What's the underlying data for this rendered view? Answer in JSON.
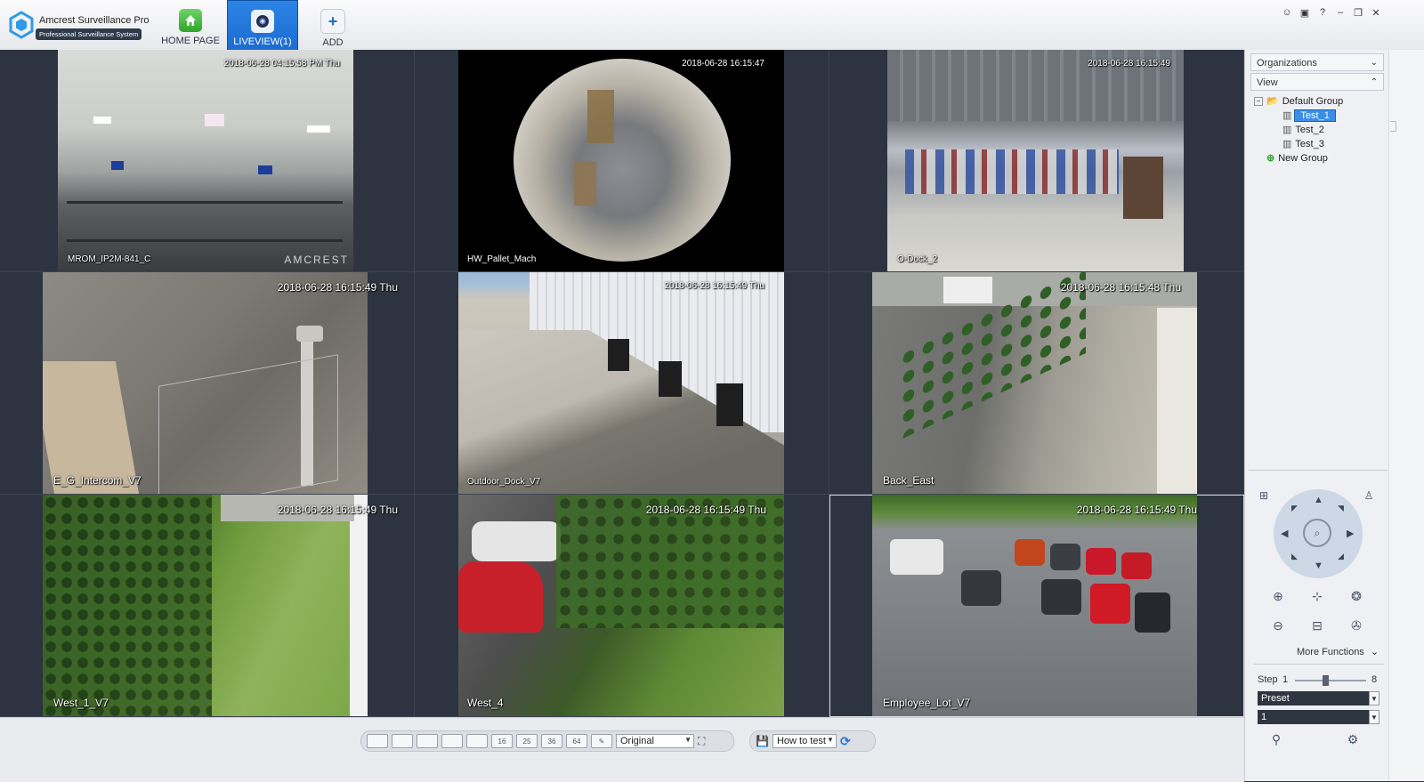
{
  "app": {
    "title": "Amcrest Surveillance Pro",
    "subtitle": "Professional Surveillance System"
  },
  "nav": {
    "tabs": [
      {
        "label": "HOME PAGE",
        "icon": "home-icon",
        "active": false
      },
      {
        "label": "LIVEVIEW(1)",
        "icon": "camera-icon",
        "active": true
      },
      {
        "label": "ADD",
        "icon": "plus-icon",
        "active": false
      }
    ]
  },
  "window_controls": [
    "user-icon",
    "lock-icon",
    "help-icon",
    "minimize-icon",
    "restore-icon",
    "close-icon"
  ],
  "window_control_glyphs": [
    "☺",
    "▣",
    "?",
    "–",
    "❐",
    "✕"
  ],
  "cameras": [
    {
      "name": "MROM_IP2M-841_C",
      "timestamp": "2018-06-28 04:15:58 PM Thu",
      "watermark": "AMCREST"
    },
    {
      "name": "HW_Pallet_Mach",
      "timestamp": "2018-06-28 16:15:47"
    },
    {
      "name": "O-Dock_2",
      "timestamp": "2018-06-28 16:15:49"
    },
    {
      "name": "E_G_Intercom_V7",
      "timestamp": "2018-06-28 16:15:49 Thu"
    },
    {
      "name": "Outdoor_Dock_V7",
      "timestamp": "2018-06-28 16:15:49 Thu"
    },
    {
      "name": "Back_East",
      "timestamp": "2018-06-28 16:15:48 Thu"
    },
    {
      "name": "West_1_V7",
      "timestamp": "2018-06-28 16:15:49 Thu"
    },
    {
      "name": "West_4",
      "timestamp": "2018-06-28 16:15:49 Thu"
    },
    {
      "name": "Employee_Lot_V7",
      "timestamp": "2018-06-28 16:15:49 Thu"
    }
  ],
  "toolbar": {
    "layouts": [
      "",
      "",
      "",
      "",
      "",
      "16",
      "25",
      "36",
      "64"
    ],
    "display_mode": "Original",
    "test_select": "How to test"
  },
  "sidepanel": {
    "organizations_label": "Organizations",
    "view_label": "View",
    "tree": [
      {
        "label": "Default Group",
        "level": 0,
        "type": "folder"
      },
      {
        "label": "Test_1",
        "level": 1,
        "type": "view",
        "selected": true
      },
      {
        "label": "Test_2",
        "level": 1,
        "type": "view"
      },
      {
        "label": "Test_3",
        "level": 1,
        "type": "view"
      },
      {
        "label": "New Group",
        "level": 0,
        "type": "new"
      }
    ],
    "more_functions": "More Functions",
    "step_label": "Step",
    "step_min": "1",
    "step_max": "8",
    "step_value": 4,
    "preset_label": "Preset",
    "preset_value": "1"
  }
}
